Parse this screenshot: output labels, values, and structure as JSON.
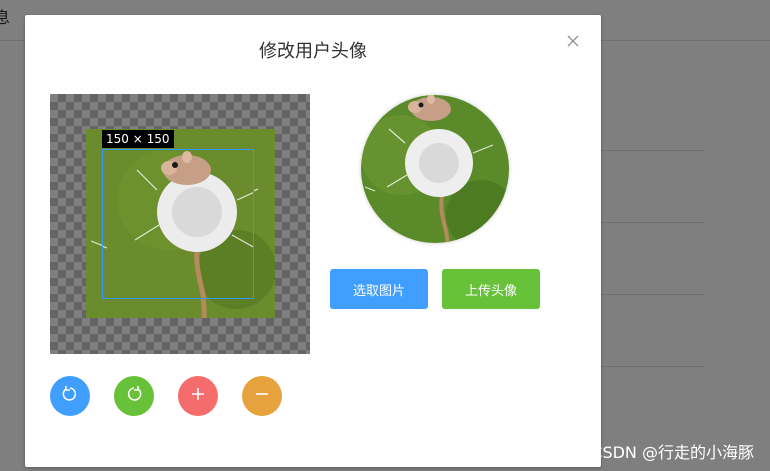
{
  "background": {
    "title_fragment": "息"
  },
  "watermark": "CSDN @行走的小海豚",
  "dialog": {
    "title": "修改用户头像",
    "close_icon": "close-icon",
    "crop_size_label": "150 × 150",
    "buttons": {
      "select_image": "选取图片",
      "upload_avatar": "上传头像"
    },
    "tools": [
      {
        "name": "rotate-left-icon",
        "color": "#409eff"
      },
      {
        "name": "rotate-right-icon",
        "color": "#67c23a"
      },
      {
        "name": "zoom-in-icon",
        "color": "#f56c6c"
      },
      {
        "name": "zoom-out-icon",
        "color": "#e6a23c"
      }
    ]
  }
}
